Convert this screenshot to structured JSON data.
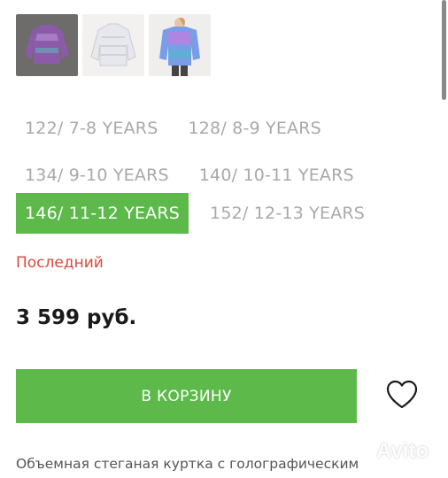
{
  "gallery": {
    "items": [
      {
        "name": "thumbnail-1",
        "accent": "#8b5aa8"
      },
      {
        "name": "thumbnail-2",
        "accent": "#e7e8ee"
      },
      {
        "name": "thumbnail-3",
        "accent": "#7a9de8"
      }
    ]
  },
  "sizes": {
    "row1": [
      "122/ 7-8 YEARS",
      "128/ 8-9 YEARS"
    ],
    "row2": [
      "134/ 9-10 YEARS",
      "140/ 10-11 YEARS"
    ],
    "row3": [
      "146/ 11-12 YEARS",
      "152/ 12-13 YEARS"
    ],
    "selected": "146/ 11-12 YEARS"
  },
  "stock_label": "Последний",
  "price": "3 599 руб.",
  "cart_button": "В КОРЗИНУ",
  "favorite_icon": "heart-icon",
  "description": "Объемная стеганая куртка с голографическим",
  "watermark": "Avito",
  "colors": {
    "accent_green": "#5cb94a",
    "stock_red": "#d84a3a",
    "size_inactive": "#a9a9a9"
  }
}
